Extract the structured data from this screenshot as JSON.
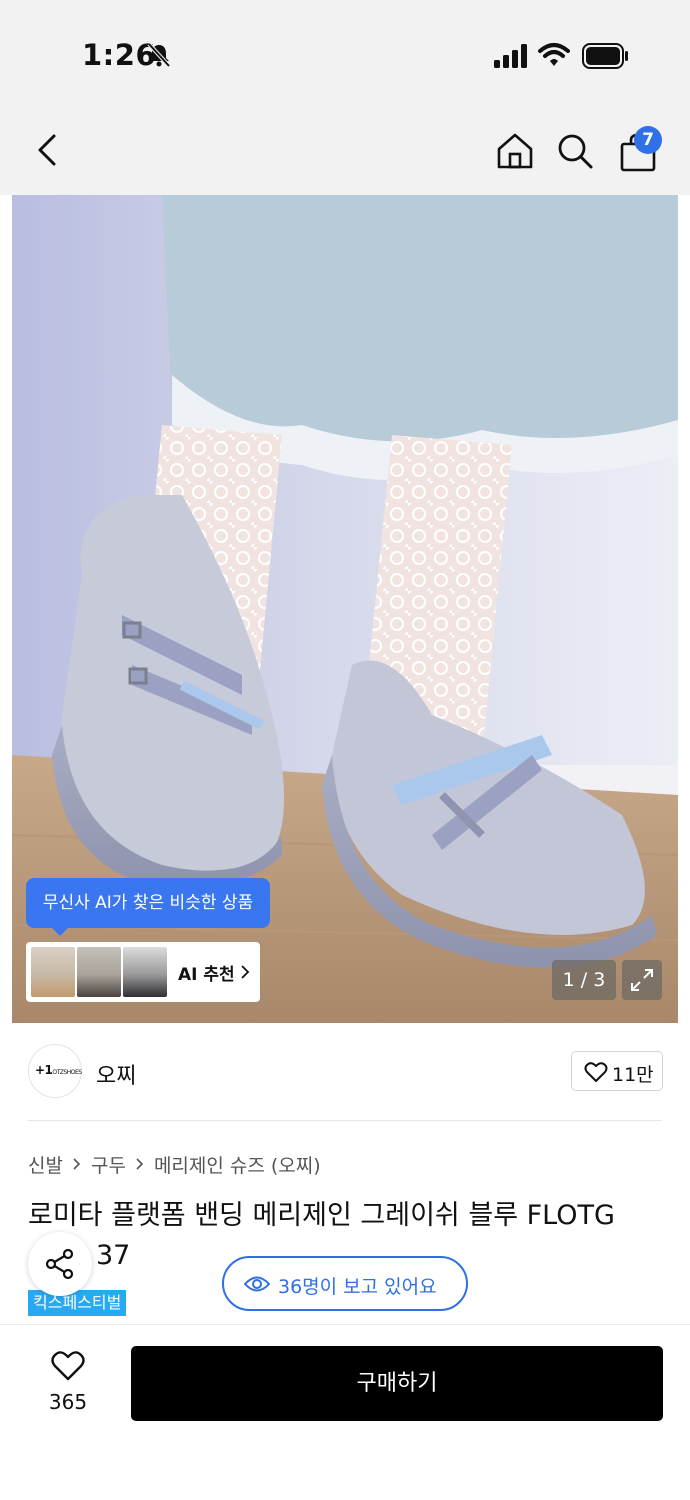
{
  "status_bar": {
    "time": "1:26"
  },
  "nav": {
    "cart_count": "7"
  },
  "gallery": {
    "ai_tooltip": "무신사 AI가 찾은 비슷한 상품",
    "ai_recommend_label": "AI 추천",
    "image_counter": "1 / 3"
  },
  "brand": {
    "name": "오찌",
    "logo_text": "+1OTZSHOES",
    "like_count": "11만"
  },
  "breadcrumb": [
    "신발",
    "구두",
    "메리제인 슈즈 (오찌)"
  ],
  "product": {
    "title_line1": "로미타 플랫폼 밴딩 메리제인 그레이쉬 블루 FLOTG",
    "title_line2": "37",
    "badge": "킥스페스티벌"
  },
  "viewers": {
    "text": "36명이 보고 있어요"
  },
  "bottom_bar": {
    "wishlist_count": "365",
    "buy_label": "구매하기"
  },
  "colors": {
    "accent_blue": "#2f6fe8",
    "badge_blue": "#27a9f3",
    "buy_button": "#000000"
  }
}
